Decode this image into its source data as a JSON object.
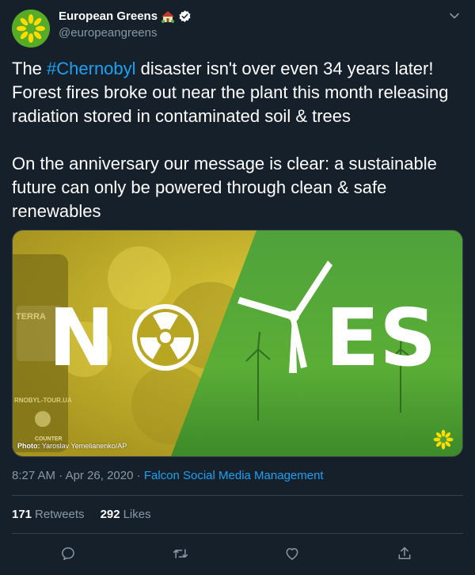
{
  "account": {
    "display_name": "European Greens",
    "handle": "@europeangreens",
    "verified": true
  },
  "tweet": {
    "text_before_hashtag": "The ",
    "hashtag": "#Chernobyl",
    "text_after_hashtag": " disaster isn't over even 34 years later! Forest fires broke out near the plant this month releasing radiation stored in contaminated soil & trees",
    "paragraph2": "On the anniversary our message is clear: a sustainable future can only be powered through clean & safe renewables"
  },
  "media": {
    "headline_left": "N",
    "headline_right": "ES",
    "meter_brand": "TERRA",
    "meter_site": "RNOBYL-TOUR.UA",
    "meter_label": "COUNTER",
    "photo_credit_bold": "Photo:",
    "photo_credit": " Yaroslav Yemelianenko/AP",
    "colors": {
      "left_bg": "#c9b82a",
      "right_bg": "#5aa833"
    }
  },
  "meta": {
    "time": "8:27 AM",
    "separator": " · ",
    "date": "Apr 26, 2020",
    "separator2": " · ",
    "source": "Falcon Social Media Management"
  },
  "stats": {
    "retweets_count": "171",
    "retweets_label": "Retweets",
    "likes_count": "292",
    "likes_label": "Likes"
  },
  "icons": {
    "reply": "reply-icon",
    "retweet": "retweet-icon",
    "like": "like-icon",
    "share": "share-icon",
    "more": "chevron-down-icon"
  },
  "theme": {
    "background": "#15202b",
    "accent": "#1da1f2",
    "secondary_text": "#8899a6",
    "border": "#38444d"
  }
}
